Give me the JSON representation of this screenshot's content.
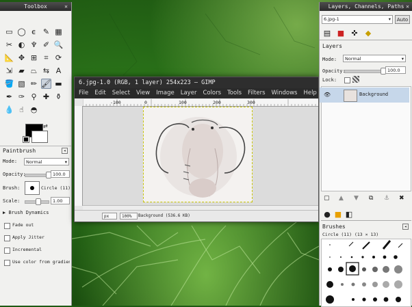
{
  "desktop": {
    "window_title_fragment": ""
  },
  "toolbox": {
    "title": "Toolbox",
    "close": "✕",
    "tools": [
      {
        "name": "rect-select-icon",
        "glyph": "▭"
      },
      {
        "name": "ellipse-select-icon",
        "glyph": "◯"
      },
      {
        "name": "free-select-icon",
        "glyph": "ϵ"
      },
      {
        "name": "fuzzy-select-icon",
        "glyph": "✎"
      },
      {
        "name": "select-by-color-icon",
        "glyph": "▦"
      },
      {
        "name": "scissors-icon",
        "glyph": "✂"
      },
      {
        "name": "foreground-select-icon",
        "glyph": "◐"
      },
      {
        "name": "paths-icon",
        "glyph": "♆"
      },
      {
        "name": "color-picker-icon",
        "glyph": "✐"
      },
      {
        "name": "zoom-icon",
        "glyph": "🔍"
      },
      {
        "name": "measure-icon",
        "glyph": "📐"
      },
      {
        "name": "move-icon",
        "glyph": "✥"
      },
      {
        "name": "align-icon",
        "glyph": "⊞"
      },
      {
        "name": "crop-icon",
        "glyph": "⌗"
      },
      {
        "name": "rotate-icon",
        "glyph": "⟳"
      },
      {
        "name": "scale-icon",
        "glyph": "⇲"
      },
      {
        "name": "shear-icon",
        "glyph": "▰"
      },
      {
        "name": "perspective-icon",
        "glyph": "⏢"
      },
      {
        "name": "flip-icon",
        "glyph": "⇆"
      },
      {
        "name": "text-icon",
        "glyph": "A"
      },
      {
        "name": "bucket-fill-icon",
        "glyph": "🪣"
      },
      {
        "name": "blend-icon",
        "glyph": "▧"
      },
      {
        "name": "pencil-icon",
        "glyph": "✏"
      },
      {
        "name": "paintbrush-icon",
        "glyph": "🖌"
      },
      {
        "name": "eraser-icon",
        "glyph": "▬"
      },
      {
        "name": "airbrush-icon",
        "glyph": "✒"
      },
      {
        "name": "ink-icon",
        "glyph": "✑"
      },
      {
        "name": "clone-icon",
        "glyph": "⚲"
      },
      {
        "name": "heal-icon",
        "glyph": "✚"
      },
      {
        "name": "perspective-clone-icon",
        "glyph": "⚱"
      },
      {
        "name": "blur-icon",
        "glyph": "💧"
      },
      {
        "name": "smudge-icon",
        "glyph": "☝"
      },
      {
        "name": "dodge-burn-icon",
        "glyph": "◓"
      }
    ],
    "active_tool_index": 23,
    "paintbrush": {
      "title": "Paintbrush",
      "mode_label": "Mode:",
      "mode_value": "Normal",
      "opacity_label": "Opacity:",
      "opacity_value": "100.0",
      "opacity_fraction": 1.0,
      "brush_label": "Brush:",
      "brush_value": "Circle (11)",
      "scale_label": "Scale:",
      "scale_value": "1.00",
      "scale_fraction": 0.55,
      "brush_dynamics": "Brush Dynamics",
      "checks": [
        "Fade out",
        "Apply Jitter",
        "Incremental",
        "Use color from gradient"
      ]
    }
  },
  "image_window": {
    "title": "6.jpg-1.0 (RGB, 1 layer) 254x223 – GIMP",
    "menus": [
      "File",
      "Edit",
      "Select",
      "View",
      "Image",
      "Layer",
      "Colors",
      "Tools",
      "Filters",
      "Windows",
      "Help"
    ],
    "ruler_labels": [
      "-100",
      "0",
      "100",
      "200",
      "300"
    ],
    "status_unit": "px",
    "status_zoom": "100%",
    "status_text": "Background (536.6 KB)"
  },
  "layers_panel": {
    "title": "Layers, Channels, Paths",
    "close": "✕",
    "image_select": "6.jpg-1",
    "auto_label": "Auto",
    "section_title": "Layers",
    "mode_label": "Mode:",
    "mode_value": "Normal",
    "opacity_label": "Opacity:",
    "opacity_value": "100.0",
    "opacity_fraction": 1.0,
    "lock_label": "Lock:",
    "layer_name": "Background",
    "brushes_title": "Brushes",
    "brush_caption": "Circle (11) (13 × 13)"
  }
}
